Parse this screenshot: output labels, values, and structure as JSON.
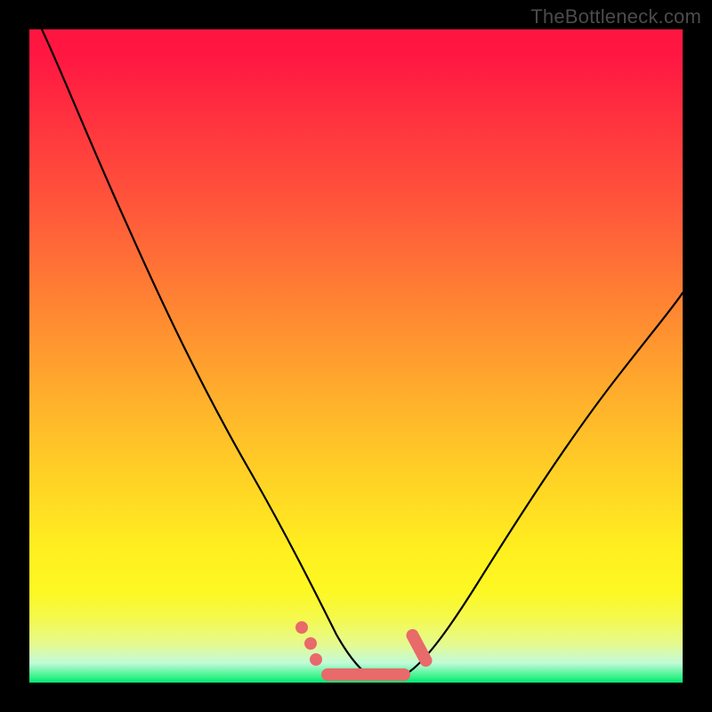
{
  "watermark": "TheBottleneck.com",
  "colors": {
    "frame": "#000000",
    "curve": "#000000",
    "marker": "#e86a6a",
    "gradient_stops": [
      {
        "pct": 0,
        "hex": "#ff163f"
      },
      {
        "pct": 4,
        "hex": "#ff1742"
      },
      {
        "pct": 28,
        "hex": "#ff593a"
      },
      {
        "pct": 45,
        "hex": "#ff8d31"
      },
      {
        "pct": 62,
        "hex": "#ffc029"
      },
      {
        "pct": 80,
        "hex": "#fff01f"
      },
      {
        "pct": 86,
        "hex": "#fdf823"
      },
      {
        "pct": 90,
        "hex": "#f5f94b"
      },
      {
        "pct": 94,
        "hex": "#e6fa8d"
      },
      {
        "pct": 97,
        "hex": "#c2fbd9"
      },
      {
        "pct": 99,
        "hex": "#40f38e"
      },
      {
        "pct": 100,
        "hex": "#00e670"
      }
    ]
  },
  "chart_data": {
    "type": "line",
    "title": "",
    "xlabel": "",
    "ylabel": "",
    "ylim": [
      0,
      100
    ],
    "xlim": [
      0,
      100
    ],
    "note": "Axes are unitless; values are pixel-estimated and rescaled to 0–100. High y = top of plot. Curve is a bottleneck V-shape with minimum near x≈52.",
    "series": [
      {
        "name": "bottleneck-curve",
        "x": [
          0,
          3,
          7,
          12,
          17,
          22,
          28,
          33,
          38,
          42,
          46,
          49,
          52,
          55,
          58,
          62,
          67,
          74,
          82,
          90,
          97,
          100
        ],
        "y": [
          104,
          98,
          90,
          80,
          70,
          60,
          48,
          38,
          28,
          19,
          11,
          5,
          2,
          2,
          5,
          10,
          18,
          28,
          40,
          50,
          58,
          62
        ]
      },
      {
        "name": "flat-optimum",
        "x": [
          44,
          46,
          48,
          50,
          52,
          54,
          56,
          58,
          60
        ],
        "y": [
          1,
          1,
          1,
          1,
          1,
          1,
          1,
          1,
          1
        ]
      }
    ],
    "markers": [
      {
        "x": 41.5,
        "y": 8.5,
        "kind": "dot"
      },
      {
        "x": 43.0,
        "y": 6.0,
        "kind": "dot"
      },
      {
        "x": 43.8,
        "y": 3.5,
        "kind": "dot"
      },
      {
        "x": 45.0,
        "y": 1.2,
        "kind": "flat-start"
      },
      {
        "x": 58.0,
        "y": 1.2,
        "kind": "flat-end"
      },
      {
        "x": 58.5,
        "y": 3.0,
        "kind": "pill-start"
      },
      {
        "x": 61.0,
        "y": 8.0,
        "kind": "pill-end"
      }
    ]
  }
}
